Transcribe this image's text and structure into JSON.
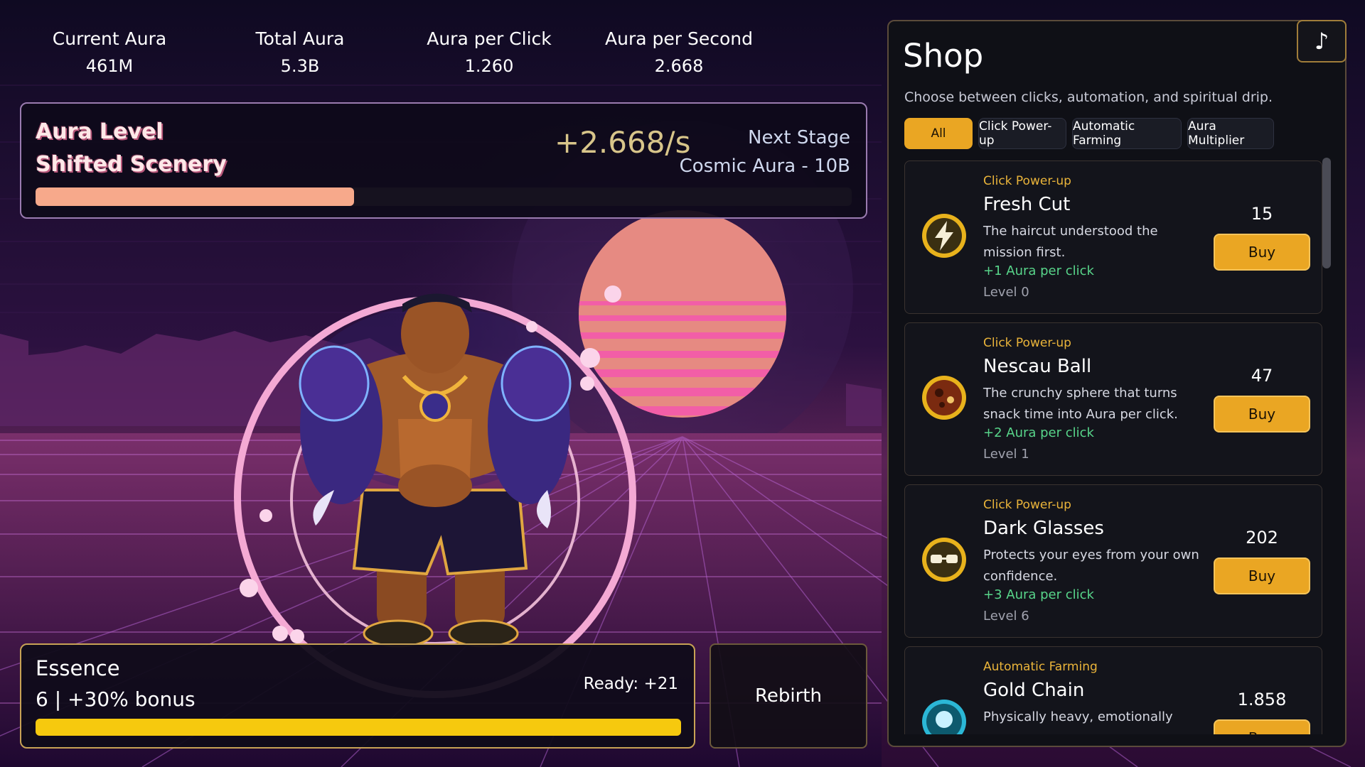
{
  "stats": [
    {
      "label": "Current Aura",
      "value": "461M"
    },
    {
      "label": "Total Aura",
      "value": "5.3B"
    },
    {
      "label": "Aura per Click",
      "value": "1.260"
    },
    {
      "label": "Aura per Second",
      "value": "2.668"
    }
  ],
  "level": {
    "title": "Aura Level",
    "stage": "Shifted Scenery",
    "rate": "+2.668/s",
    "next_label": "Next Stage",
    "next_stage": "Cosmic Aura - 10B",
    "progress": 0.39
  },
  "essence": {
    "title": "Essence",
    "info": "6 | +30% bonus",
    "ready": "Ready: +21",
    "progress": 1.0
  },
  "rebirth_label": "Rebirth",
  "shop": {
    "title": "Shop",
    "music_icon": "♪",
    "description": "Choose between clicks, automation, and spiritual drip.",
    "filters": [
      "All",
      "Click Power-up",
      "Automatic Farming",
      "Aura Multiplier"
    ],
    "active_filter": "All",
    "items": [
      {
        "category": "Click Power-up",
        "name": "Fresh Cut",
        "description": "The haircut understood the mission first.",
        "effect": "+1 Aura per click",
        "level": "Level 0",
        "price": "15",
        "buy": "Buy",
        "icon": "lightning-icon"
      },
      {
        "category": "Click Power-up",
        "name": "Nescau Ball",
        "description": "The crunchy sphere that turns snack time into Aura per click.",
        "effect": "+2 Aura per click",
        "level": "Level 1",
        "price": "47",
        "buy": "Buy",
        "icon": "ball-icon"
      },
      {
        "category": "Click Power-up",
        "name": "Dark Glasses",
        "description": "Protects your eyes from your own confidence.",
        "effect": "+3 Aura per click",
        "level": "Level 6",
        "price": "202",
        "buy": "Buy",
        "icon": "glasses-icon"
      },
      {
        "category": "Automatic Farming",
        "name": "Gold Chain",
        "description": "Physically heavy, emotionally",
        "effect": "",
        "level": "",
        "price": "1.858",
        "buy": "Buy",
        "icon": "chain-icon"
      }
    ]
  },
  "colors": {
    "accent": "#eaa623",
    "level_bar": "#f7a98b",
    "essence_bar": "#f6c90e",
    "effect_green": "#58d58a",
    "category_gold": "#eab43a"
  }
}
